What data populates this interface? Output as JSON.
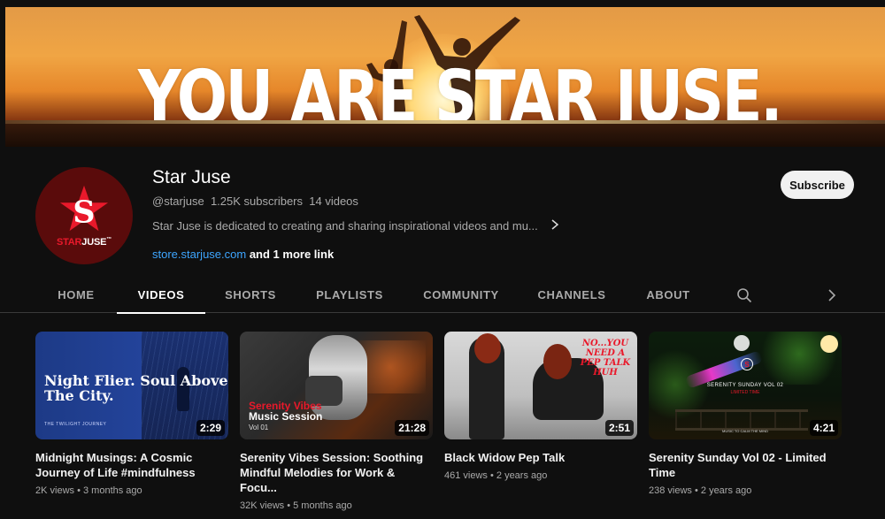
{
  "banner": {
    "text": "YOU ARE STAR JUSE."
  },
  "channel": {
    "name": "Star Juse",
    "handle": "@starjuse",
    "subscribers": "1.25K subscribers",
    "videos": "14 videos",
    "description": "Star Juse is dedicated to creating and sharing inspirational videos and mu...",
    "link_text": "store.starjuse.com",
    "more_links": "and 1 more link",
    "logo_text_red": "STAR",
    "logo_text_white": "JUSE",
    "logo_tm": "™"
  },
  "subscribe_label": "Subscribe",
  "tabs": [
    {
      "label": "HOME",
      "active": false
    },
    {
      "label": "VIDEOS",
      "active": true
    },
    {
      "label": "SHORTS",
      "active": false
    },
    {
      "label": "PLAYLISTS",
      "active": false
    },
    {
      "label": "COMMUNITY",
      "active": false
    },
    {
      "label": "CHANNELS",
      "active": false
    },
    {
      "label": "ABOUT",
      "active": false
    }
  ],
  "icons": {
    "search": "search-icon",
    "next": "chevron-right-icon",
    "desc_more": "chevron-right-icon"
  },
  "videos": [
    {
      "title_line1": "Midnight Musings: A Cosmic",
      "title_line2": "Journey of Life #mindfulness",
      "views": "2K views",
      "age": "3 months ago",
      "duration": "2:29",
      "thumb_text": "Night Flier. Soul Above The City.",
      "thumb_sub": "THE TWILIGHT JOURNEY"
    },
    {
      "title_line1": "Serenity Vibes Session: Soothing",
      "title_line2": "Mindful Melodies for Work & Focu...",
      "views": "32K views",
      "age": "5 months ago",
      "duration": "21:28",
      "thumb_label1": "Serenity Vibes",
      "thumb_label2": "Music Session",
      "thumb_label3": "Vol 01"
    },
    {
      "title_line1": "Black Widow Pep Talk",
      "title_line2": "",
      "views": "461 views",
      "age": "2 years ago",
      "duration": "2:51",
      "thumb_text": "NO...YOU NEED A PEP TALK HUH"
    },
    {
      "title_line1": "Serenity Sunday Vol 02 - Limited",
      "title_line2": "Time",
      "views": "238 views",
      "age": "2 years ago",
      "duration": "4:21",
      "thumb_text": "SERENITY SUNDAY VOL 02",
      "thumb_sub": "LIMITED TIME",
      "thumb_bottom": "MUSIC TO CALM THE MIND"
    }
  ],
  "colors": {
    "background": "#0f0f0f",
    "accent_red": "#e9192b",
    "link": "#3ea6ff"
  }
}
